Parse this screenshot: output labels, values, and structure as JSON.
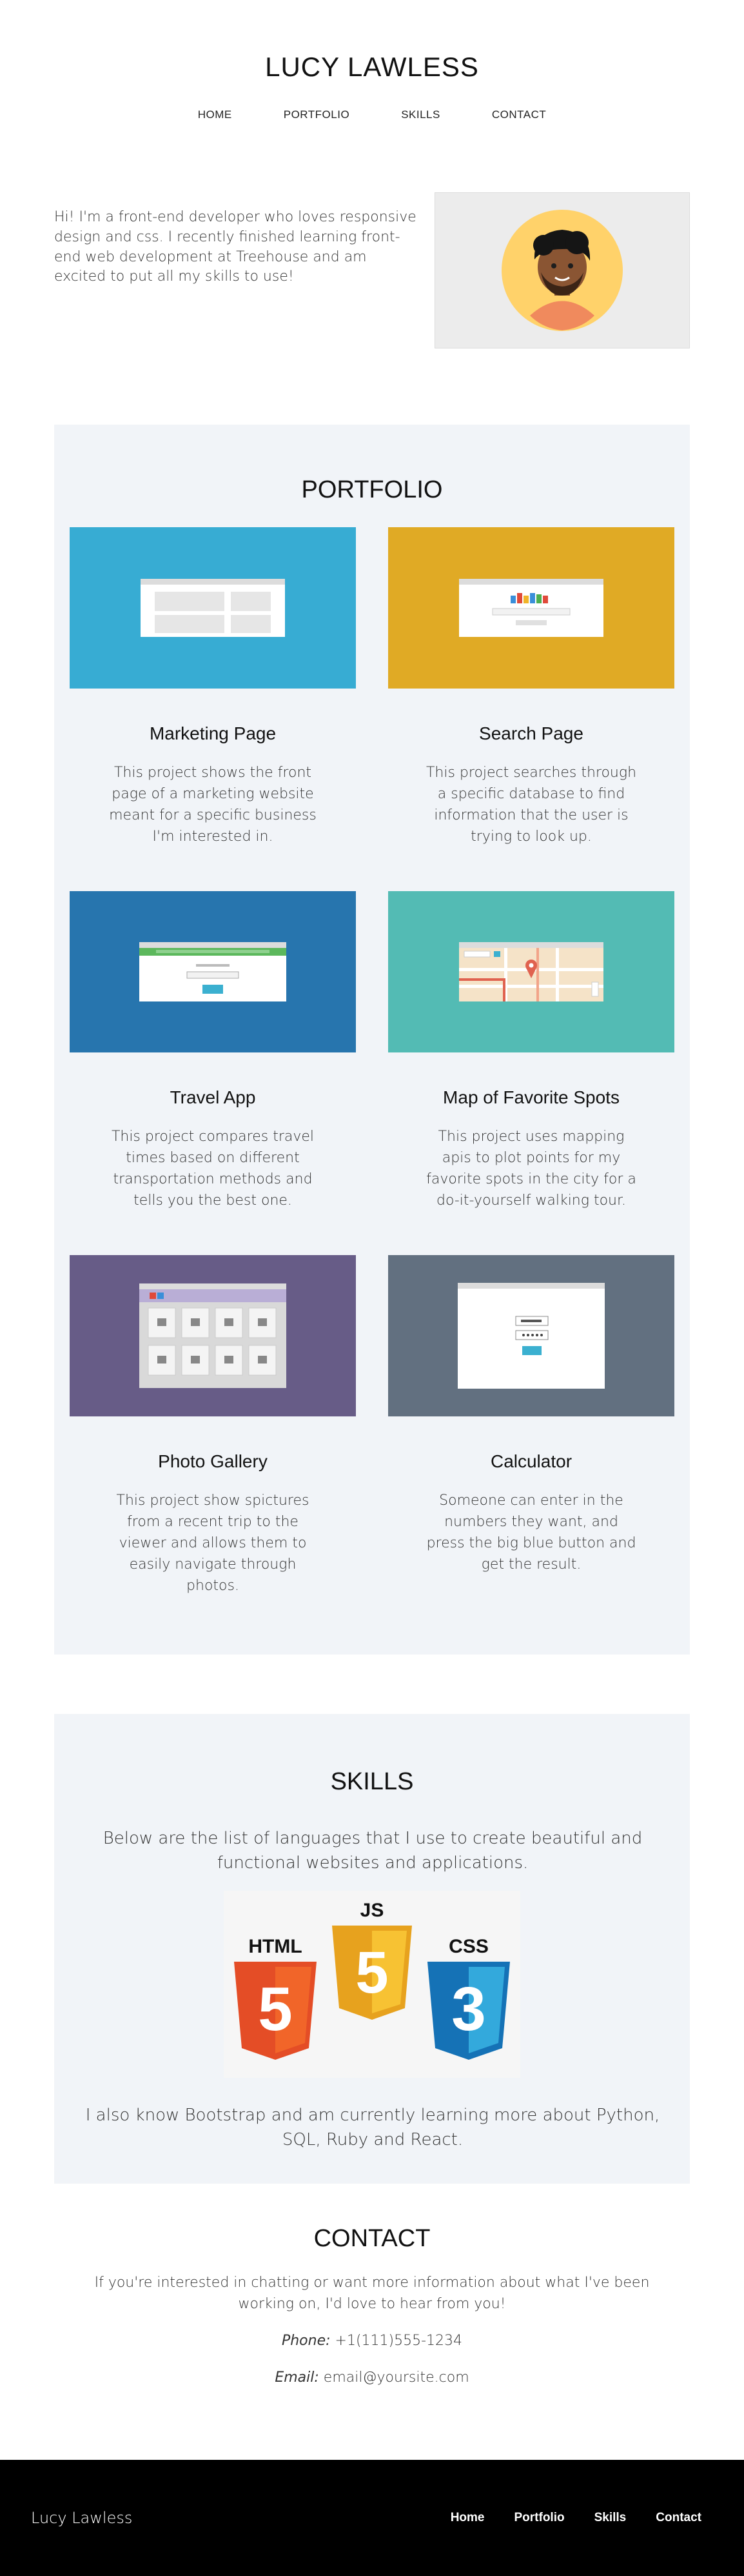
{
  "header": {
    "title": "LUCY LAWLESS",
    "nav": [
      {
        "label": "HOME"
      },
      {
        "label": "PORTFOLIO"
      },
      {
        "label": "SKILLS"
      },
      {
        "label": "CONTACT"
      }
    ]
  },
  "intro": {
    "text": "Hi! I'm a front-end developer who loves responsive design and css. I recently finished learning front-end web development at Treehouse and am excited to put all my skills to use!"
  },
  "portfolio": {
    "title": "PORTFOLIO",
    "projects": [
      {
        "title": "Marketing Page",
        "desc": "This project shows the front page of a marketing website meant for a specific business I'm interested in.",
        "color": "#37acd3"
      },
      {
        "title": "Search Page",
        "desc": "This project searches through a specific database to find information that the user is trying to look up.",
        "color": "#e0aa25"
      },
      {
        "title": "Travel App",
        "desc": "This project compares travel times based on different transportation methods and tells you the best one.",
        "color": "#2775ae"
      },
      {
        "title": "Map of Favorite Spots",
        "desc": "This project uses mapping apis to plot points for my favorite spots in the city for a do-it-yourself walking tour.",
        "color": "#53bbb4"
      },
      {
        "title": "Photo Gallery",
        "desc": "This project show spictures from a recent trip to the viewer and allows them to easily navigate through photos.",
        "color": "#675c87"
      },
      {
        "title": "Calculator",
        "desc": "Someone can enter in the numbers they want, and press the big blue button and get the result.",
        "color": "#627080"
      }
    ]
  },
  "skills": {
    "title": "SKILLS",
    "intro": "Below are the list of languages that I use to create beautiful and functional websites and applications.",
    "logos": [
      {
        "label": "HTML",
        "number": "5",
        "color": "#e44d26"
      },
      {
        "label": "JS",
        "number": "5",
        "color": "#f0a818"
      },
      {
        "label": "CSS",
        "number": "3",
        "color": "#1b73ba"
      }
    ],
    "outro": "I also know Bootstrap and am currently learning more about Python, SQL, Ruby and React."
  },
  "contact": {
    "title": "CONTACT",
    "intro": "If you're interested in chatting or want more information about what I've been working on, I'd love to hear from you!",
    "phone_label": "Phone:",
    "phone": "+1(111)555-1234",
    "email_label": "Email:",
    "email": "email@yoursite.com"
  },
  "footer": {
    "brand": "Lucy Lawless",
    "nav": [
      {
        "label": "Home"
      },
      {
        "label": "Portfolio"
      },
      {
        "label": "Skills"
      },
      {
        "label": "Contact"
      }
    ]
  }
}
